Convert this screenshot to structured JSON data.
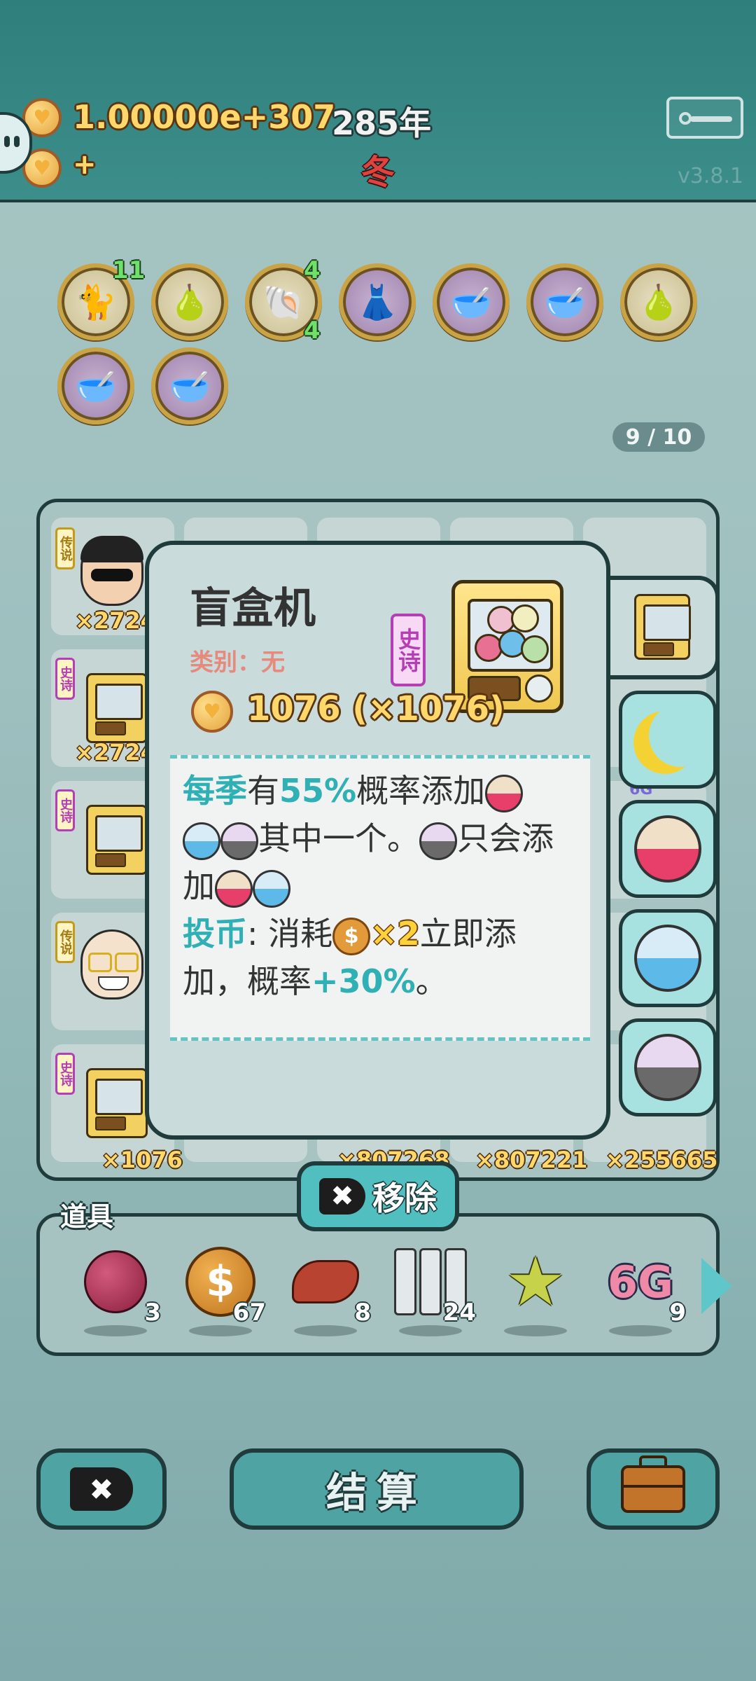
{
  "topbar": {
    "money": "1.00000e+307",
    "money_plus": "+",
    "year": "285年",
    "season": "冬",
    "version": "v3.8.1"
  },
  "relics": {
    "counts": [
      "11",
      "4",
      "4"
    ],
    "page": "9 / 10"
  },
  "board": {
    "rarity_legend": "传说",
    "rarity_epic": "史诗",
    "counts": [
      "×2724",
      "×2724",
      "×1076",
      "×807268",
      "×807221",
      "×255665"
    ],
    "partial_tag": "6G"
  },
  "card": {
    "title": "盲盒机",
    "category": "类别：无",
    "rarity": "史诗",
    "price": "1076 (×1076)",
    "desc": {
      "kw1": "每季",
      "t1": "有",
      "pct": "55%",
      "t2": "概率添加",
      "t3": "其中一个。",
      "t4": "只会添加",
      "kw2": "投币",
      "t5": ": 消耗",
      "mult": "×2",
      "t6": "立即添加，概率",
      "bonus": "+30%",
      "t7": "。"
    }
  },
  "buttons": {
    "remove": "移除",
    "remove_x": "✖",
    "settle": "结算",
    "close_x": "✖"
  },
  "items": {
    "label": "道具",
    "list": [
      {
        "icon": "lychee-icon",
        "count": "3"
      },
      {
        "icon": "dollar-coin-icon",
        "count": "67"
      },
      {
        "icon": "liver-icon",
        "count": "8"
      },
      {
        "icon": "server-rack-icon",
        "count": "24"
      },
      {
        "icon": "star-icon",
        "count": ""
      },
      {
        "icon": "6g-icon",
        "label": "6G",
        "count": "9"
      }
    ]
  },
  "colors": {
    "accent": "#51bfc0",
    "gold": "#ffd76b",
    "epic": "#b43fb4",
    "keyword": "#2fb0b5"
  }
}
